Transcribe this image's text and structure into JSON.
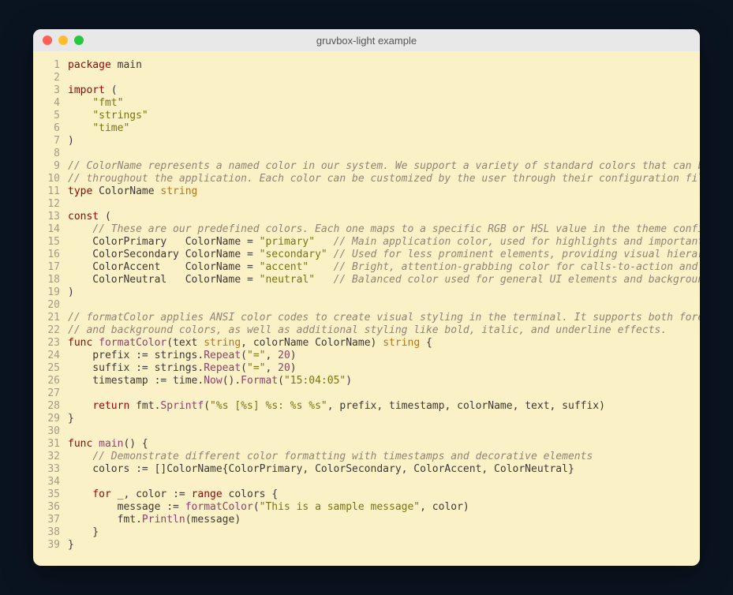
{
  "window": {
    "title": "gruvbox-light example"
  },
  "theme": {
    "bg": "#fbf1c7",
    "fg": "#3c3836",
    "keyword": "#9d0006",
    "string": "#79740e",
    "type": "#b57614",
    "comment": "#928374",
    "function": "#8f3f71",
    "number": "#8f3f71",
    "gutter": "#a89984"
  },
  "code": {
    "line_count": 39,
    "lines": [
      [
        [
          "kw",
          "package"
        ],
        [
          "iden",
          " main"
        ]
      ],
      [],
      [
        [
          "kw",
          "import"
        ],
        [
          "iden",
          " ("
        ]
      ],
      [
        [
          "iden",
          "    "
        ],
        [
          "str",
          "\"fmt\""
        ]
      ],
      [
        [
          "iden",
          "    "
        ],
        [
          "str",
          "\"strings\""
        ]
      ],
      [
        [
          "iden",
          "    "
        ],
        [
          "str",
          "\"time\""
        ]
      ],
      [
        [
          "iden",
          ")"
        ]
      ],
      [],
      [
        [
          "com",
          "// ColorName represents a named color in our system. We support a variety of standard colors that can be used"
        ]
      ],
      [
        [
          "com",
          "// throughout the application. Each color can be customized by the user through their configuration file."
        ]
      ],
      [
        [
          "kw",
          "type"
        ],
        [
          "iden",
          " ColorName "
        ],
        [
          "typ",
          "string"
        ]
      ],
      [],
      [
        [
          "kw",
          "const"
        ],
        [
          "iden",
          " ("
        ]
      ],
      [
        [
          "iden",
          "    "
        ],
        [
          "com",
          "// These are our predefined colors. Each one maps to a specific RGB or HSL value in the theme configuration."
        ]
      ],
      [
        [
          "iden",
          "    ColorPrimary   ColorName = "
        ],
        [
          "str",
          "\"primary\""
        ],
        [
          "iden",
          "   "
        ],
        [
          "com",
          "// Main application color, used for highlights and important UI elements"
        ]
      ],
      [
        [
          "iden",
          "    ColorSecondary ColorName = "
        ],
        [
          "str",
          "\"secondary\""
        ],
        [
          "iden",
          " "
        ],
        [
          "com",
          "// Used for less prominent elements, providing visual hierarchy"
        ]
      ],
      [
        [
          "iden",
          "    ColorAccent    ColorName = "
        ],
        [
          "str",
          "\"accent\""
        ],
        [
          "iden",
          "    "
        ],
        [
          "com",
          "// Bright, attention-grabbing color for calls-to-action and highlights"
        ]
      ],
      [
        [
          "iden",
          "    ColorNeutral   ColorName = "
        ],
        [
          "str",
          "\"neutral\""
        ],
        [
          "iden",
          "   "
        ],
        [
          "com",
          "// Balanced color used for general UI elements and backgrounds"
        ]
      ],
      [
        [
          "iden",
          ")"
        ]
      ],
      [],
      [
        [
          "com",
          "// formatColor applies ANSI color codes to create visual styling in the terminal. It supports both foreground"
        ]
      ],
      [
        [
          "com",
          "// and background colors, as well as additional styling like bold, italic, and underline effects."
        ]
      ],
      [
        [
          "kw",
          "func"
        ],
        [
          "iden",
          " "
        ],
        [
          "fn",
          "formatColor"
        ],
        [
          "iden",
          "(text "
        ],
        [
          "typ",
          "string"
        ],
        [
          "iden",
          ", colorName ColorName) "
        ],
        [
          "typ",
          "string"
        ],
        [
          "iden",
          " {"
        ]
      ],
      [
        [
          "iden",
          "    prefix "
        ],
        [
          "op",
          ":="
        ],
        [
          "iden",
          " strings."
        ],
        [
          "fn",
          "Repeat"
        ],
        [
          "iden",
          "("
        ],
        [
          "str",
          "\"=\""
        ],
        [
          "iden",
          ", "
        ],
        [
          "num",
          "20"
        ],
        [
          "iden",
          ")"
        ]
      ],
      [
        [
          "iden",
          "    suffix "
        ],
        [
          "op",
          ":="
        ],
        [
          "iden",
          " strings."
        ],
        [
          "fn",
          "Repeat"
        ],
        [
          "iden",
          "("
        ],
        [
          "str",
          "\"=\""
        ],
        [
          "iden",
          ", "
        ],
        [
          "num",
          "20"
        ],
        [
          "iden",
          ")"
        ]
      ],
      [
        [
          "iden",
          "    timestamp "
        ],
        [
          "op",
          ":="
        ],
        [
          "iden",
          " time."
        ],
        [
          "fn",
          "Now"
        ],
        [
          "iden",
          "()."
        ],
        [
          "fn",
          "Format"
        ],
        [
          "iden",
          "("
        ],
        [
          "str",
          "\"15:04:05\""
        ],
        [
          "iden",
          ")"
        ]
      ],
      [],
      [
        [
          "iden",
          "    "
        ],
        [
          "kw",
          "return"
        ],
        [
          "iden",
          " fmt."
        ],
        [
          "fn",
          "Sprintf"
        ],
        [
          "iden",
          "("
        ],
        [
          "str",
          "\"%s [%s] %s: %s %s\""
        ],
        [
          "iden",
          ", prefix, timestamp, colorName, text, suffix)"
        ]
      ],
      [
        [
          "iden",
          "}"
        ]
      ],
      [],
      [
        [
          "kw",
          "func"
        ],
        [
          "iden",
          " "
        ],
        [
          "fn",
          "main"
        ],
        [
          "iden",
          "() {"
        ]
      ],
      [
        [
          "iden",
          "    "
        ],
        [
          "com",
          "// Demonstrate different color formatting with timestamps and decorative elements"
        ]
      ],
      [
        [
          "iden",
          "    colors "
        ],
        [
          "op",
          ":="
        ],
        [
          "iden",
          " []ColorName{ColorPrimary, ColorSecondary, ColorAccent, ColorNeutral}"
        ]
      ],
      [],
      [
        [
          "iden",
          "    "
        ],
        [
          "kw",
          "for"
        ],
        [
          "iden",
          " _, color "
        ],
        [
          "op",
          ":="
        ],
        [
          "iden",
          " "
        ],
        [
          "kw",
          "range"
        ],
        [
          "iden",
          " colors {"
        ]
      ],
      [
        [
          "iden",
          "        message "
        ],
        [
          "op",
          ":="
        ],
        [
          "iden",
          " "
        ],
        [
          "fn",
          "formatColor"
        ],
        [
          "iden",
          "("
        ],
        [
          "str",
          "\"This is a sample message\""
        ],
        [
          "iden",
          ", color)"
        ]
      ],
      [
        [
          "iden",
          "        fmt."
        ],
        [
          "fn",
          "Println"
        ],
        [
          "iden",
          "(message)"
        ]
      ],
      [
        [
          "iden",
          "    }"
        ]
      ],
      [
        [
          "iden",
          "}"
        ]
      ]
    ]
  }
}
